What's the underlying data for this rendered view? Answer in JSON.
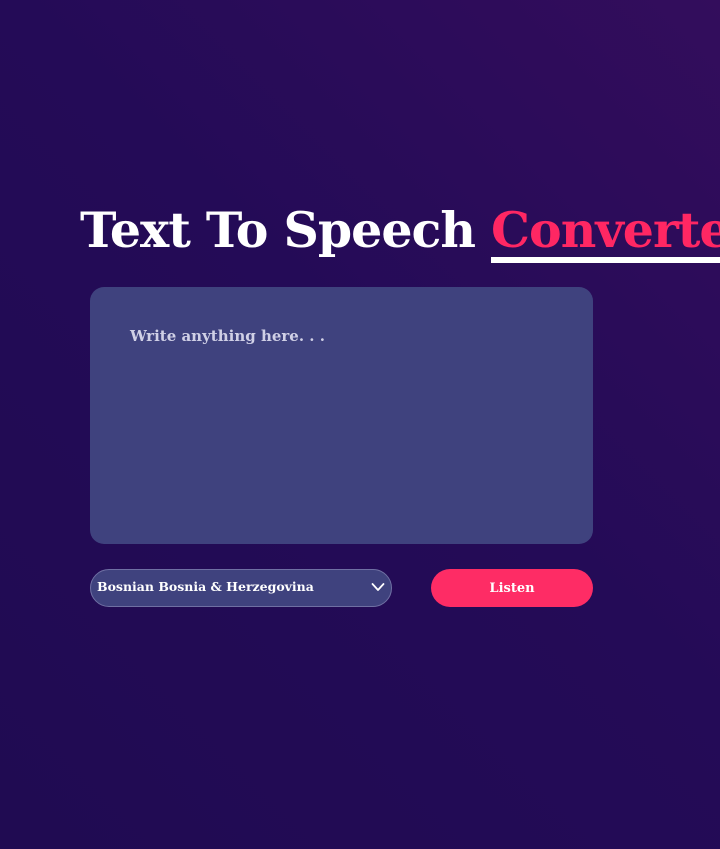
{
  "header": {
    "title_main": "Text To Speech ",
    "title_accent": "Converter"
  },
  "editor": {
    "placeholder": "Write anything here. . .",
    "value": ""
  },
  "controls": {
    "language_selected": "Bosnian Bosnia & Herzegovina",
    "listen_label": "Listen"
  },
  "colors": {
    "accent": "#ff2763",
    "panel": "#3f427e",
    "background": "#240b57"
  },
  "icons": {
    "select_arrow": "chevron-down-icon"
  }
}
